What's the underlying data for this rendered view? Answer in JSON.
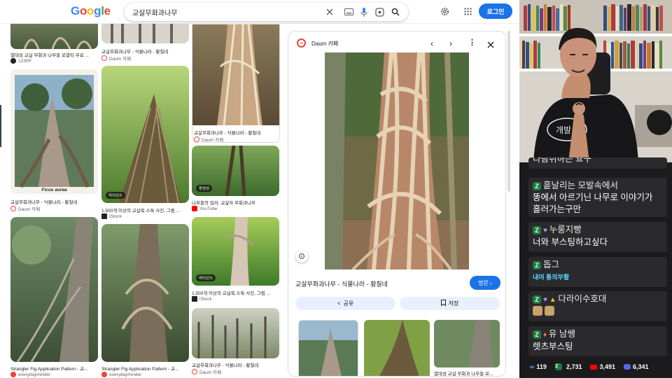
{
  "search": {
    "query": "교살무화과나무",
    "login_label": "로그인"
  },
  "grid": {
    "cards": [
      {
        "title": "열대성 교살 무화과 나무들 로열티 무료 ...",
        "source": "123RF",
        "fav": "#222"
      },
      {
        "title": "교살무화과나무 - 식물나라 - 황칠네",
        "source": "Daum 카페",
        "fav": "#e8453c"
      },
      {
        "title": "교살무화과나무 - 식물나라 - 황칠네",
        "source": "Daum 카페",
        "fav": "#e8453c"
      },
      {
        "title": "교살무화과나무 - 식물나라 - 황칠네",
        "source": "Daum 카페",
        "fav": "#e8453c",
        "caption": "Ficus aurea"
      },
      {
        "title": "1,500개 이상의 교살목 스톡 사진, 그림 ...",
        "source": "iStock",
        "fav": "#222",
        "badge": "라이선스"
      },
      {
        "title": "나무들의 킬러, 교살자 무화과나무",
        "source": "YouTube",
        "fav": "#ff0000",
        "badge": "동영상"
      },
      {
        "title": "1,500개 이상의 교살목 스톡 사진, 그림 ...",
        "source": "iStock",
        "fav": "#222",
        "badge": "라이선스"
      },
      {
        "title": "Strangler Fig Application Pattern - 교...",
        "source": "everydayminder",
        "fav": "#e8453c"
      },
      {
        "title": "Strangler Fig Application Pattern - 교...",
        "source": "everydayminder",
        "fav": "#e8453c"
      },
      {
        "title": "교살무화과나무 - 식물나라 - 황칠네",
        "source": "Daum 카페",
        "fav": "#e8453c"
      }
    ]
  },
  "panel": {
    "source": "Daum 카페",
    "title": "교살무화과나무 - 식물나라 - 황칠네",
    "visit_label": "방문 ›",
    "share_label": "공유",
    "save_label": "저장",
    "related_caption": "열대성 교살 무화과 나무들 로..."
  },
  "chat": [
    {
      "name": "",
      "text": "다람쥐하는 요구"
    },
    {
      "name": "흩날리는 모발속에서",
      "text": "똥에서 아르기닌 나무로 이야기가 흘러가는구만"
    },
    {
      "name": "누룽지빵",
      "text": "너와 부스팅하고싶다"
    },
    {
      "name": "돕그",
      "text": "내여 통의부활"
    },
    {
      "name": "다라이수호대",
      "text": ""
    },
    {
      "name": "유 남쌩",
      "text": "렛츠부스팅"
    }
  ],
  "stats": {
    "viewers_a": "119",
    "viewers_b": "2,731",
    "viewers_c": "3,491",
    "viewers_d": "6,341"
  },
  "colors": {
    "accent": "#1a73e8",
    "chat_bg": "#2a2a2c",
    "stream_bg": "#1b1b1d"
  }
}
